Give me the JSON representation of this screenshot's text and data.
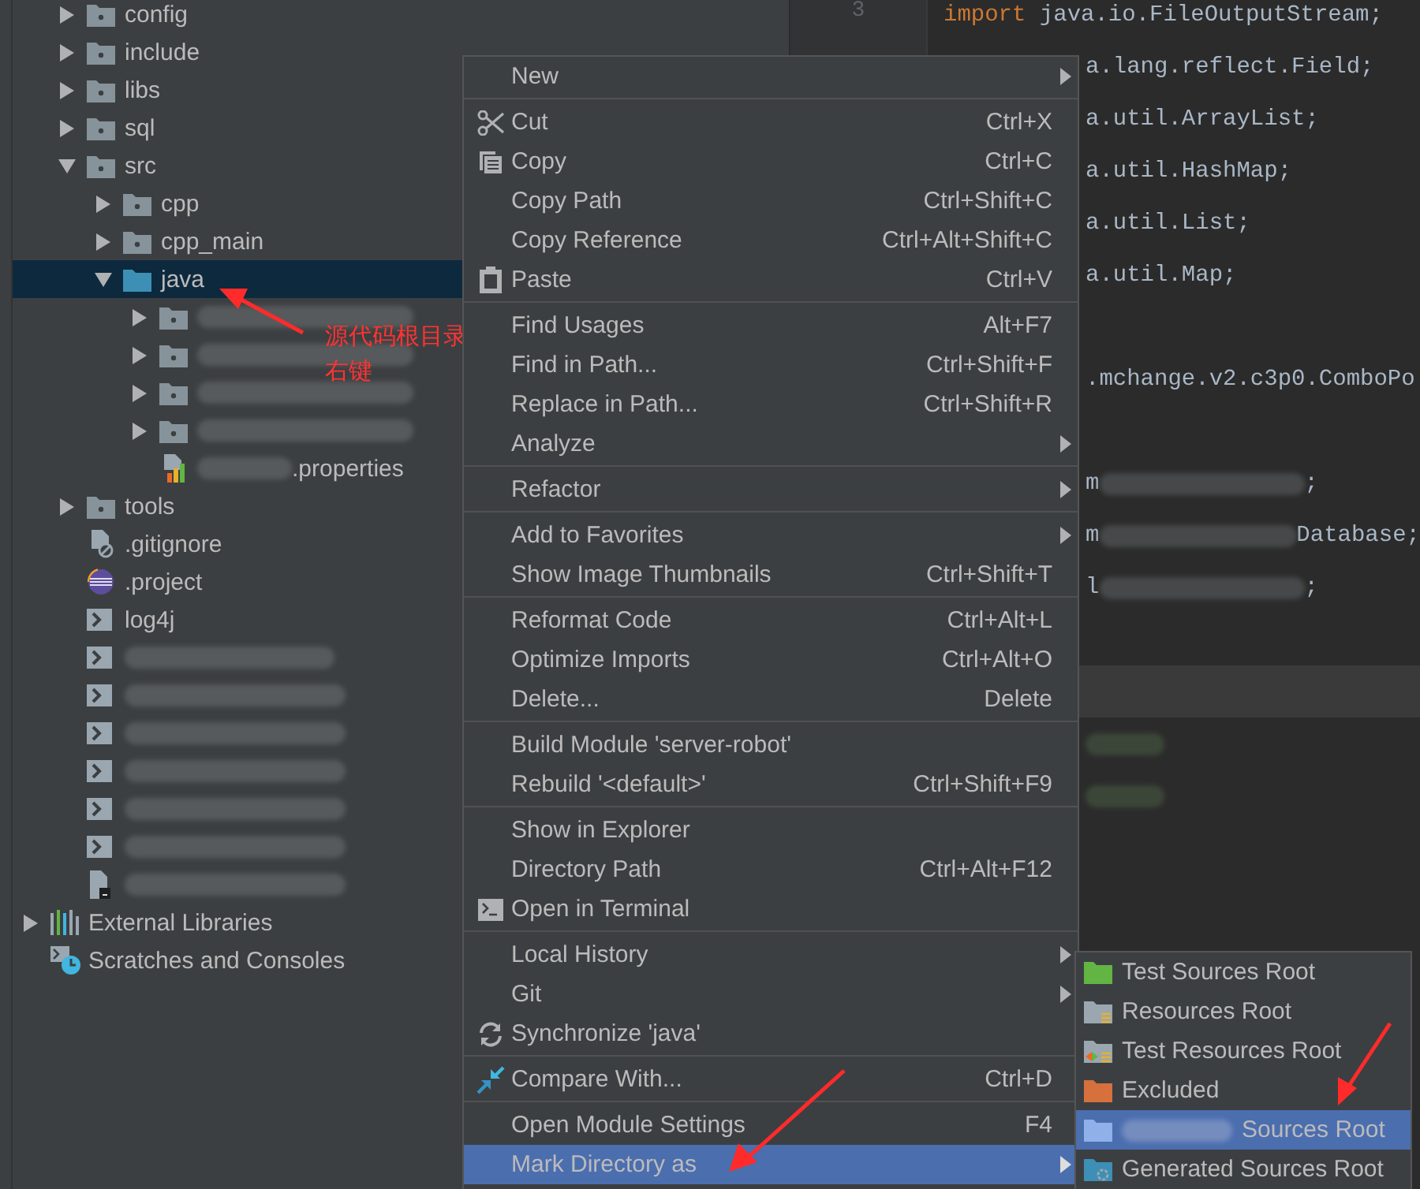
{
  "tree": {
    "module_items": [
      {
        "label": "config",
        "kind": "folder",
        "expanded": false,
        "selected": false
      },
      {
        "label": "include",
        "kind": "folder",
        "expanded": false,
        "selected": false
      },
      {
        "label": "libs",
        "kind": "folder",
        "expanded": false,
        "selected": false
      },
      {
        "label": "sql",
        "kind": "folder",
        "expanded": false,
        "selected": false
      },
      {
        "label": "src",
        "kind": "folder",
        "expanded": true,
        "selected": false,
        "children": [
          {
            "label": "cpp",
            "kind": "folder",
            "expanded": false,
            "selected": false
          },
          {
            "label": "cpp_main",
            "kind": "folder",
            "expanded": false,
            "selected": false
          },
          {
            "label": "java",
            "kind": "source_folder",
            "expanded": true,
            "selected": true,
            "children": [
              {
                "kind": "folder",
                "expanded": false,
                "selected": false,
                "redacted": true
              },
              {
                "kind": "folder",
                "expanded": false,
                "selected": false,
                "redacted": true
              },
              {
                "kind": "folder",
                "expanded": false,
                "selected": false,
                "redacted": true
              },
              {
                "kind": "folder",
                "expanded": false,
                "selected": false,
                "redacted": true
              },
              {
                "label": ".properties",
                "kind": "properties",
                "selected": false,
                "redacted": true
              }
            ]
          }
        ]
      },
      {
        "label": "tools",
        "kind": "folder",
        "expanded": false,
        "selected": false
      },
      {
        "label": ".gitignore",
        "kind": "gitignore",
        "selected": false
      },
      {
        "label": ".project",
        "kind": "eclipse",
        "selected": false
      },
      {
        "label": "log4j",
        "kind": "script",
        "selected": false
      },
      {
        "kind": "script",
        "selected": false,
        "redacted": true
      },
      {
        "kind": "script",
        "selected": false,
        "redacted": true
      },
      {
        "kind": "script",
        "selected": false,
        "redacted": true
      },
      {
        "kind": "script",
        "selected": false,
        "redacted": true
      },
      {
        "kind": "script",
        "selected": false,
        "redacted": true
      },
      {
        "kind": "script",
        "selected": false,
        "redacted": true
      },
      {
        "kind": "console_file",
        "selected": false,
        "redacted": true
      }
    ],
    "root_items": [
      {
        "label": "External Libraries",
        "kind": "libraries",
        "expanded": false,
        "selected": false
      },
      {
        "label": "Scratches and Consoles",
        "kind": "scratches",
        "selected": false
      }
    ]
  },
  "annotation": {
    "lines": [
      "源代码根目录",
      "右键"
    ]
  },
  "editor": {
    "line_number": "3",
    "lines": [
      {
        "kind": "full",
        "current": false,
        "segments": [
          {
            "kind": "keyword",
            "text": "import"
          },
          {
            "kind": "text",
            "text": " java.io.FileOutputStream;"
          }
        ]
      },
      {
        "kind": "partial",
        "current": false,
        "segments": [
          {
            "kind": "text",
            "text": "a.lang.reflect.Field;"
          }
        ]
      },
      {
        "kind": "partial",
        "current": false,
        "segments": [
          {
            "kind": "text",
            "text": "a.util.ArrayList;"
          }
        ]
      },
      {
        "kind": "partial",
        "current": false,
        "segments": [
          {
            "kind": "text",
            "text": "a.util.HashMap;"
          }
        ]
      },
      {
        "kind": "partial",
        "current": false,
        "segments": [
          {
            "kind": "text",
            "text": "a.util.List;"
          }
        ]
      },
      {
        "kind": "partial",
        "current": false,
        "segments": [
          {
            "kind": "text",
            "text": "a.util.Map;"
          }
        ]
      },
      {
        "kind": "partial",
        "current": false
      },
      {
        "kind": "partial",
        "current": false,
        "segments": [
          {
            "kind": "text",
            "text": ".mchange.v2.c3p0.ComboPo"
          }
        ]
      },
      {
        "kind": "partial",
        "current": false
      },
      {
        "kind": "partial",
        "current": false,
        "segments": [
          {
            "kind": "text",
            "text": "m"
          },
          {
            "kind": "redacted"
          },
          {
            "kind": "text",
            "text": ";"
          }
        ]
      },
      {
        "kind": "partial",
        "current": false,
        "segments": [
          {
            "kind": "text",
            "text": "m"
          },
          {
            "kind": "redacted"
          },
          {
            "kind": "text",
            "text": "Database;"
          }
        ]
      },
      {
        "kind": "partial",
        "current": false,
        "segments": [
          {
            "kind": "text",
            "text": "l"
          },
          {
            "kind": "redacted"
          },
          {
            "kind": "text",
            "text": ";"
          }
        ]
      },
      {
        "kind": "partial",
        "current": false
      },
      {
        "kind": "partial",
        "current": true
      },
      {
        "kind": "partial",
        "current": false,
        "segments": [
          {
            "kind": "redacted"
          }
        ]
      },
      {
        "kind": "partial",
        "current": false,
        "segments": [
          {
            "kind": "redacted"
          }
        ]
      }
    ]
  },
  "context_menu": {
    "groups": [
      {
        "items": [
          {
            "label": "New",
            "has_submenu": true,
            "selected": false
          }
        ]
      },
      {
        "items": [
          {
            "label": "Cut",
            "shortcut": "Ctrl+X",
            "kind": "cut",
            "selected": false
          },
          {
            "label": "Copy",
            "shortcut": "Ctrl+C",
            "kind": "copy",
            "selected": false
          },
          {
            "label": "Copy Path",
            "shortcut": "Ctrl+Shift+C",
            "selected": false
          },
          {
            "label": "Copy Reference",
            "shortcut": "Ctrl+Alt+Shift+C",
            "selected": false
          },
          {
            "label": "Paste",
            "shortcut": "Ctrl+V",
            "kind": "paste",
            "selected": false
          }
        ]
      },
      {
        "items": [
          {
            "label": "Find Usages",
            "shortcut": "Alt+F7",
            "selected": false
          },
          {
            "label": "Find in Path...",
            "shortcut": "Ctrl+Shift+F",
            "selected": false
          },
          {
            "label": "Replace in Path...",
            "shortcut": "Ctrl+Shift+R",
            "selected": false
          },
          {
            "label": "Analyze",
            "has_submenu": true,
            "selected": false
          }
        ]
      },
      {
        "items": [
          {
            "label": "Refactor",
            "has_submenu": true,
            "selected": false
          }
        ]
      },
      {
        "items": [
          {
            "label": "Add to Favorites",
            "has_submenu": true,
            "selected": false
          },
          {
            "label": "Show Image Thumbnails",
            "shortcut": "Ctrl+Shift+T",
            "selected": false
          }
        ]
      },
      {
        "items": [
          {
            "label": "Reformat Code",
            "shortcut": "Ctrl+Alt+L",
            "selected": false
          },
          {
            "label": "Optimize Imports",
            "shortcut": "Ctrl+Alt+O",
            "selected": false
          },
          {
            "label": "Delete...",
            "shortcut": "Delete",
            "selected": false
          }
        ]
      },
      {
        "items": [
          {
            "label": "Build Module 'server-robot'",
            "selected": false
          },
          {
            "label": "Rebuild '<default>'",
            "shortcut": "Ctrl+Shift+F9",
            "selected": false
          }
        ]
      },
      {
        "items": [
          {
            "label": "Show in Explorer",
            "selected": false
          },
          {
            "label": "Directory Path",
            "shortcut": "Ctrl+Alt+F12",
            "selected": false
          },
          {
            "label": "Open in Terminal",
            "kind": "terminal",
            "selected": false
          }
        ]
      },
      {
        "items": [
          {
            "label": "Local History",
            "has_submenu": true,
            "selected": false
          },
          {
            "label": "Git",
            "has_submenu": true,
            "selected": false
          },
          {
            "label": "Synchronize 'java'",
            "kind": "sync",
            "selected": false
          }
        ]
      },
      {
        "items": [
          {
            "label": "Compare With...",
            "shortcut": "Ctrl+D",
            "kind": "compare",
            "selected": false
          }
        ]
      },
      {
        "items": [
          {
            "label": "Open Module Settings",
            "shortcut": "F4",
            "selected": false
          },
          {
            "label": "Mark Directory as",
            "has_submenu": true,
            "selected": true
          }
        ]
      }
    ]
  },
  "submenu": {
    "items": [
      {
        "label": "Test Sources Root",
        "kind": "test_sources",
        "selected": false
      },
      {
        "label": "Resources Root",
        "kind": "resources",
        "selected": false
      },
      {
        "label": "Test Resources Root",
        "kind": "test_resources",
        "selected": false
      },
      {
        "label": "Excluded",
        "kind": "excluded",
        "selected": false
      },
      {
        "label": "Sources Root",
        "kind": "sources",
        "selected": true,
        "redacted": true
      },
      {
        "label": "Generated Sources Root",
        "kind": "generated",
        "selected": false
      }
    ]
  }
}
